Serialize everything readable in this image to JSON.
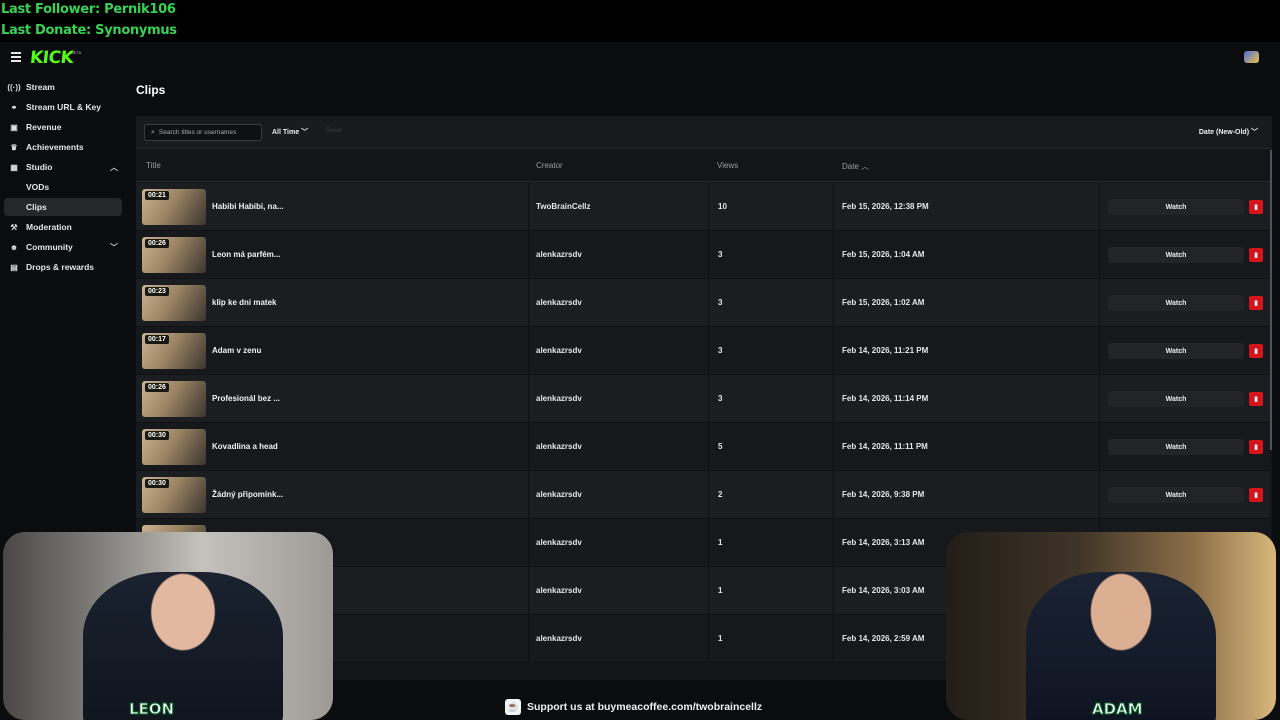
{
  "overlay": {
    "last_follower": "Last Follower: Pernik106",
    "last_donate": "Last Donate: Synonymus"
  },
  "app": {
    "logo": "KICK",
    "logo_badge": "BETA"
  },
  "sidebar": {
    "items": [
      {
        "label": "Stream",
        "icon": "broadcast-icon"
      },
      {
        "label": "Stream URL & Key",
        "icon": "link-icon"
      },
      {
        "label": "Revenue",
        "icon": "wallet-icon"
      },
      {
        "label": "Achievements",
        "icon": "trophy-icon"
      },
      {
        "label": "Studio",
        "icon": "studio-icon",
        "expanded": true
      },
      {
        "label": "VODs",
        "icon": ""
      },
      {
        "label": "Clips",
        "icon": "",
        "active": true
      },
      {
        "label": "Moderation",
        "icon": "hammer-icon"
      },
      {
        "label": "Community",
        "icon": "people-icon",
        "expanded": false
      },
      {
        "label": "Drops & rewards",
        "icon": "gift-icon"
      }
    ]
  },
  "page": {
    "title": "Clips"
  },
  "filters": {
    "search_placeholder": "Search titles or usernames",
    "time_range": "All Time",
    "reset": "Reset",
    "sort": "Date (New-Old)"
  },
  "table": {
    "columns": [
      "Title",
      "Creator",
      "Views",
      "Date"
    ],
    "watch_label": "Watch",
    "rows": [
      {
        "duration": "00:21",
        "title": "Habibi Habibi, na...",
        "creator": "TwoBrainCellz",
        "views": "10",
        "date": "Feb 15, 2026, 12:38 PM"
      },
      {
        "duration": "00:26",
        "title": "Leon má parfém...",
        "creator": "alenkazrsdv",
        "views": "3",
        "date": "Feb 15, 2026, 1:04 AM"
      },
      {
        "duration": "00:23",
        "title": "klip ke dni matek",
        "creator": "alenkazrsdv",
        "views": "3",
        "date": "Feb 15, 2026, 1:02 AM"
      },
      {
        "duration": "00:17",
        "title": "Adam v zenu",
        "creator": "alenkazrsdv",
        "views": "3",
        "date": "Feb 14, 2026, 11:21 PM"
      },
      {
        "duration": "00:26",
        "title": "Profesionál bez ...",
        "creator": "alenkazrsdv",
        "views": "3",
        "date": "Feb 14, 2026, 11:14 PM"
      },
      {
        "duration": "00:30",
        "title": "Kovadlina a head",
        "creator": "alenkazrsdv",
        "views": "5",
        "date": "Feb 14, 2026, 11:11 PM"
      },
      {
        "duration": "00:30",
        "title": "Žádný připomínk...",
        "creator": "alenkazrsdv",
        "views": "2",
        "date": "Feb 14, 2026, 9:38 PM"
      },
      {
        "duration": "",
        "title": "",
        "creator": "alenkazrsdv",
        "views": "1",
        "date": "Feb 14, 2026, 3:13 AM"
      },
      {
        "duration": "",
        "title": "",
        "creator": "alenkazrsdv",
        "views": "1",
        "date": "Feb 14, 2026, 3:03 AM"
      },
      {
        "duration": "",
        "title": "",
        "creator": "alenkazrsdv",
        "views": "1",
        "date": "Feb 14, 2026, 2:59 AM"
      }
    ]
  },
  "webcams": {
    "left_name": "LEON",
    "right_name": "ADAM"
  },
  "banner": {
    "text": "Support us at buymeacoffee.com/twobraincellz"
  },
  "colors": {
    "brand": "#53fc18",
    "delete": "#d4161c",
    "overlay_text": "#39d353"
  }
}
